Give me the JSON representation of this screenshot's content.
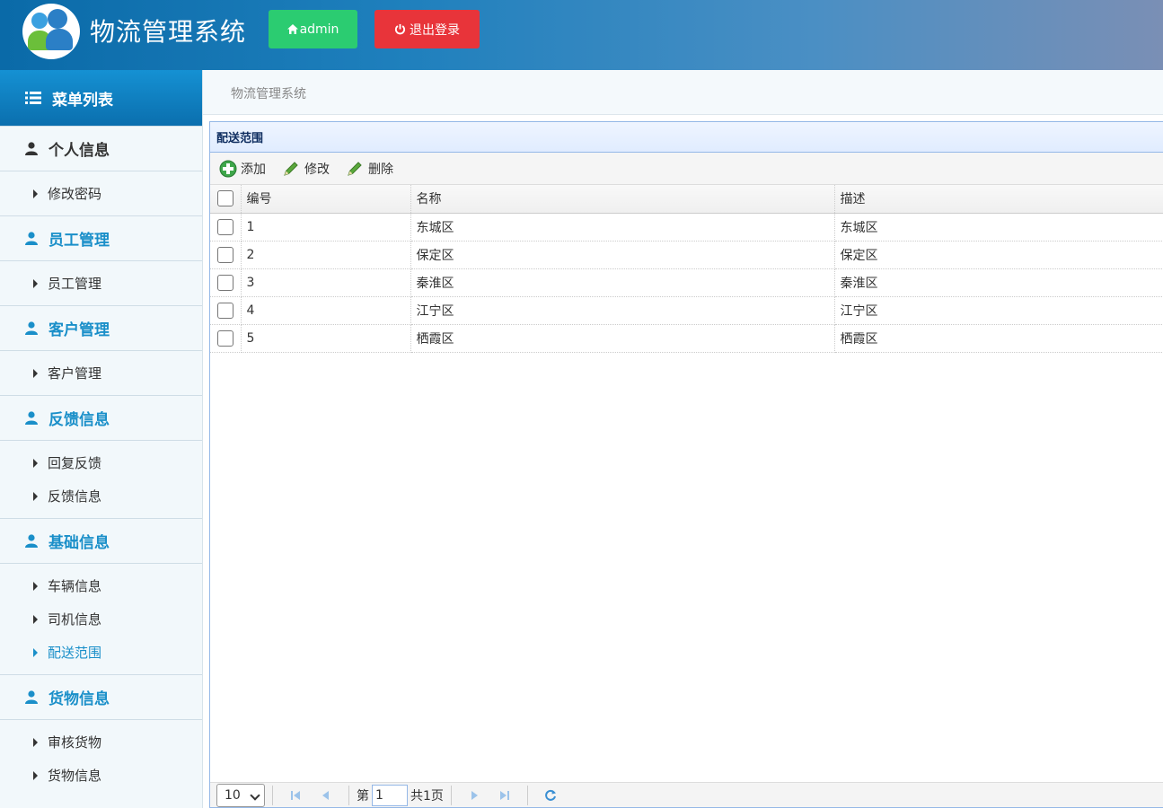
{
  "header": {
    "title": "物流管理系统",
    "admin_label": "admin",
    "logout_label": "退出登录"
  },
  "sidebar": {
    "heading": "菜单列表",
    "groups": [
      {
        "title": "个人信息",
        "items": [
          "修改密码"
        ]
      },
      {
        "title": "员工管理",
        "items": [
          "员工管理"
        ]
      },
      {
        "title": "客户管理",
        "items": [
          "客户管理"
        ]
      },
      {
        "title": "反馈信息",
        "items": [
          "回复反馈",
          "反馈信息"
        ]
      },
      {
        "title": "基础信息",
        "items": [
          "车辆信息",
          "司机信息",
          "配送范围"
        ]
      },
      {
        "title": "货物信息",
        "items": [
          "审核货物",
          "货物信息"
        ]
      }
    ]
  },
  "breadcrumb": "物流管理系统",
  "panel": {
    "title": "配送范围",
    "toolbar": {
      "add": "添加",
      "edit": "修改",
      "delete": "删除"
    },
    "columns": [
      "编号",
      "名称",
      "描述"
    ],
    "rows": [
      [
        "1",
        "东城区",
        "东城区"
      ],
      [
        "2",
        "保定区",
        "保定区"
      ],
      [
        "3",
        "秦淮区",
        "秦淮区"
      ],
      [
        "4",
        "江宁区",
        "江宁区"
      ],
      [
        "5",
        "栖霞区",
        "栖霞区"
      ]
    ]
  },
  "pager": {
    "page_size": "10",
    "page_prefix": "第",
    "current_page": "1",
    "page_total": "共1页"
  },
  "colors": {
    "accent": "#1a8fc9",
    "admin_button": "#2bcc71",
    "logout_button": "#e8343a"
  }
}
